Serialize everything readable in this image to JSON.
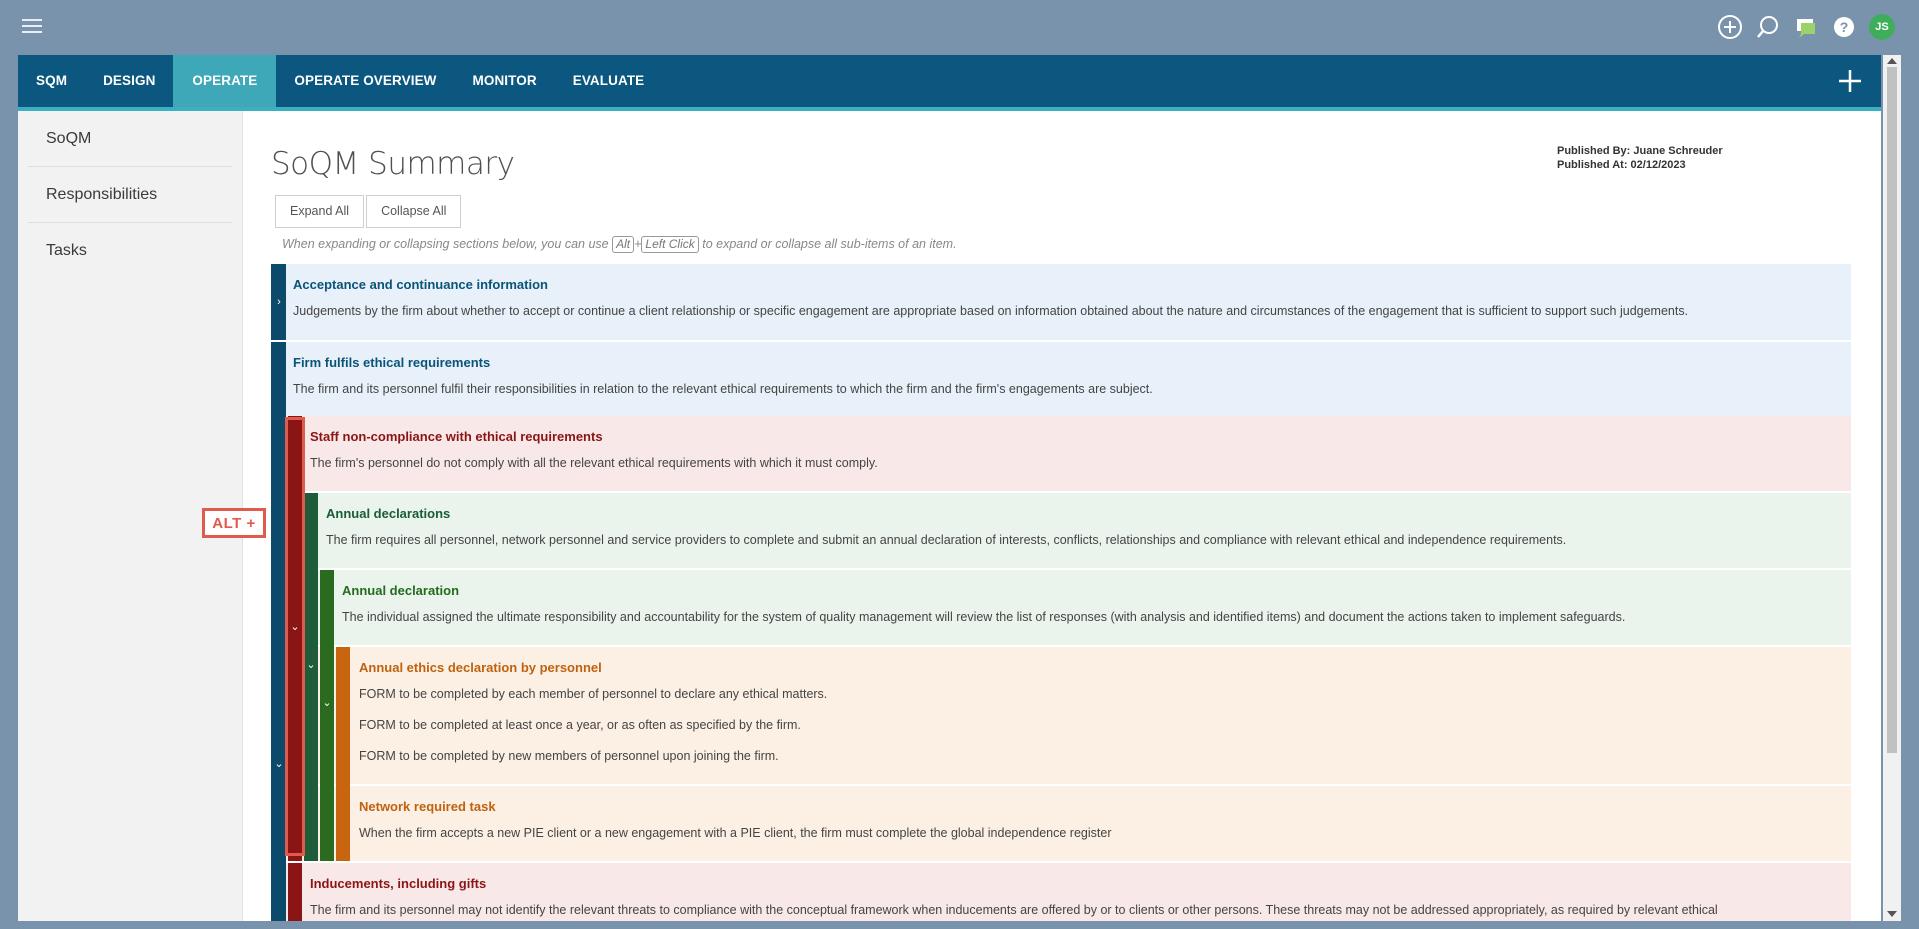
{
  "app": {
    "avatar_initials": "JS",
    "accent": "#0c5780",
    "active_tab_color": "#3ea7b8"
  },
  "nav": {
    "tabs": [
      {
        "label": "SQM",
        "active": false
      },
      {
        "label": "DESIGN",
        "active": false
      },
      {
        "label": "OPERATE",
        "active": true
      },
      {
        "label": "OPERATE OVERVIEW",
        "active": false
      },
      {
        "label": "MONITOR",
        "active": false
      },
      {
        "label": "EVALUATE",
        "active": false
      }
    ]
  },
  "sidebar": {
    "items": [
      {
        "label": "SoQM"
      },
      {
        "label": "Responsibilities"
      },
      {
        "label": "Tasks"
      }
    ]
  },
  "main": {
    "title": "SoQM Summary",
    "published_by": "Published By: Juane Schreuder",
    "published_at": "Published At: 02/12/2023",
    "expand_all": "Expand All",
    "collapse_all": "Collapse All",
    "hint_before": "When expanding or collapsing sections below, you can use",
    "hint_key1": "Alt",
    "hint_plus": "+",
    "hint_key2": "Left Click",
    "hint_after": "to expand or collapse all sub-items of an item.",
    "alt_badge": "ALT +"
  },
  "tree": [
    {
      "title": "Acceptance and continuance information",
      "lines": [
        "Judgements by the firm about whether to accept or continue a client relationship or specific engagement are appropriate based on information obtained about the nature and circumstances of the engagement that is sufficient to support such judgements."
      ]
    },
    {
      "title": "Firm fulfils ethical requirements",
      "lines": [
        "The firm and its personnel fulfil their responsibilities in relation to the relevant ethical requirements to which the firm and the firm's engagements are subject."
      ]
    },
    {
      "title": "Staff non-compliance with ethical requirements",
      "lines": [
        "The firm's personnel do not comply with all the relevant ethical requirements with which it must comply."
      ]
    },
    {
      "title": "Annual declarations",
      "lines": [
        "The firm requires all personnel, network personnel and service providers to complete and submit an annual declaration of interests, conflicts, relationships and compliance with relevant ethical and independence requirements."
      ]
    },
    {
      "title": "Annual declaration",
      "lines": [
        "The individual assigned the ultimate responsibility and accountability for the system of quality management will review the list of responses (with analysis and identified items) and document the actions taken to implement safeguards."
      ]
    },
    {
      "title": "Annual ethics declaration by personnel",
      "lines": [
        "FORM to be completed by each member of personnel to declare any ethical matters.",
        "FORM to be completed at least once a year, or as often as specified by the firm.",
        "FORM to be completed by new members of personnel upon joining the firm."
      ]
    },
    {
      "title": "Network required task",
      "lines": [
        "When the firm accepts a new PIE client or a new engagement with a PIE client, the firm must complete the global independence register"
      ]
    },
    {
      "title": "Inducements, including gifts",
      "lines": [
        "The firm and its personnel may not identify the relevant threats to compliance with the conceptual framework when inducements are offered by or to clients or other persons. These threats may not be addressed appropriately, as required by relevant ethical"
      ]
    }
  ]
}
